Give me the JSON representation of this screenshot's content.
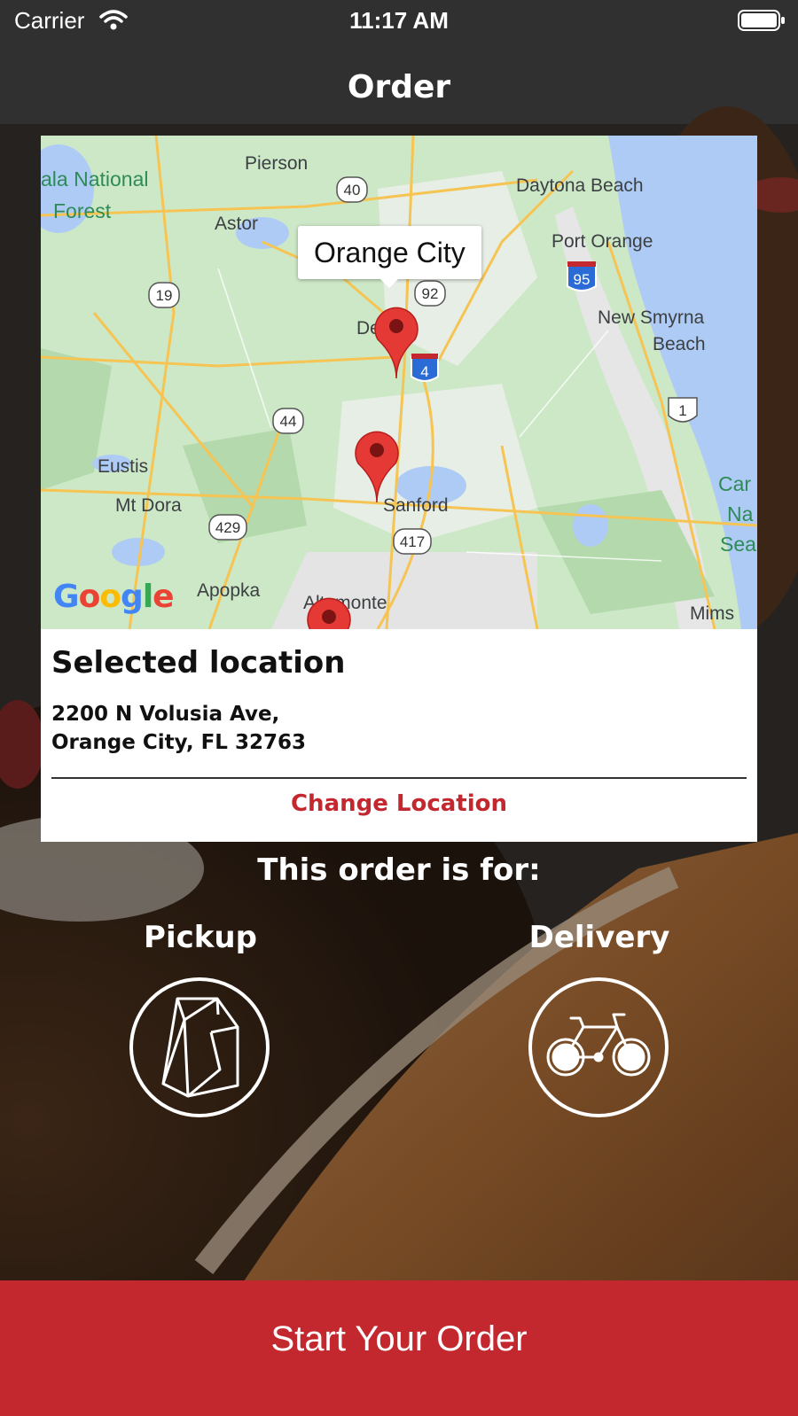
{
  "status_bar": {
    "carrier": "Carrier",
    "time": "11:17 AM"
  },
  "header": {
    "title": "Order"
  },
  "map": {
    "callout": "Orange City",
    "labels": {
      "ocala": "ala National",
      "forest": "Forest",
      "pierson": "Pierson",
      "daytona": "Daytona Beach",
      "astor": "Astor",
      "port_orange": "Port Orange",
      "new_smyrna": "New Smyrna",
      "beach": "Beach",
      "deland": "Deland",
      "eustis": "Eustis",
      "mt_dora": "Mt Dora",
      "sanford": "Sanford",
      "apopka": "Apopka",
      "altamonte": "Altamonte",
      "mims": "Mims",
      "canaveral_1": "Car",
      "canaveral_2": "Na",
      "canaveral_3": "Sea"
    },
    "shields": {
      "r40": "40",
      "r92": "92",
      "r19": "19",
      "i4": "4",
      "i95": "95",
      "r44": "44",
      "us1": "1",
      "r429": "429",
      "r417": "417"
    },
    "logo": "Google"
  },
  "location": {
    "heading": "Selected location",
    "address_line1": "2200 N Volusia Ave,",
    "address_line2": "Orange City, FL 32763",
    "change_label": "Change Location"
  },
  "order_type": {
    "prompt": "This order is for:",
    "pickup_label": "Pickup",
    "delivery_label": "Delivery"
  },
  "cta": {
    "label": "Start Your Order"
  },
  "colors": {
    "accent": "#c4282f"
  }
}
